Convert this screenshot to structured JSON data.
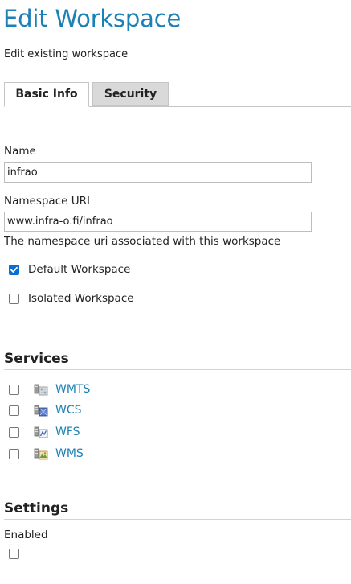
{
  "header": {
    "title": "Edit Workspace",
    "subtitle": "Edit existing workspace"
  },
  "tabs": [
    {
      "label": "Basic Info",
      "active": true
    },
    {
      "label": "Security",
      "active": false
    }
  ],
  "form": {
    "name_label": "Name",
    "name_value": "infrao",
    "namespace_label": "Namespace URI",
    "namespace_value": "www.infra-o.fi/infrao",
    "namespace_help": "The namespace uri associated with this workspace",
    "default_workspace": {
      "label": "Default Workspace",
      "checked": true
    },
    "isolated_workspace": {
      "label": "Isolated Workspace",
      "checked": false
    }
  },
  "services": {
    "heading": "Services",
    "items": [
      {
        "label": "WMTS",
        "checked": false,
        "icon": "wmts-service-icon"
      },
      {
        "label": "WCS",
        "checked": false,
        "icon": "wcs-service-icon"
      },
      {
        "label": "WFS",
        "checked": false,
        "icon": "wfs-service-icon"
      },
      {
        "label": "WMS",
        "checked": false,
        "icon": "wms-service-icon"
      }
    ]
  },
  "settings": {
    "heading": "Settings",
    "enabled_label": "Enabled",
    "enabled_checked": false
  },
  "colors": {
    "title": "#1a80b6",
    "link": "#1a80b6",
    "checkbox_checked": "#0d6ed1",
    "inactive_tab": "#d9d9d9",
    "section_rule": "#d8d8a8"
  }
}
